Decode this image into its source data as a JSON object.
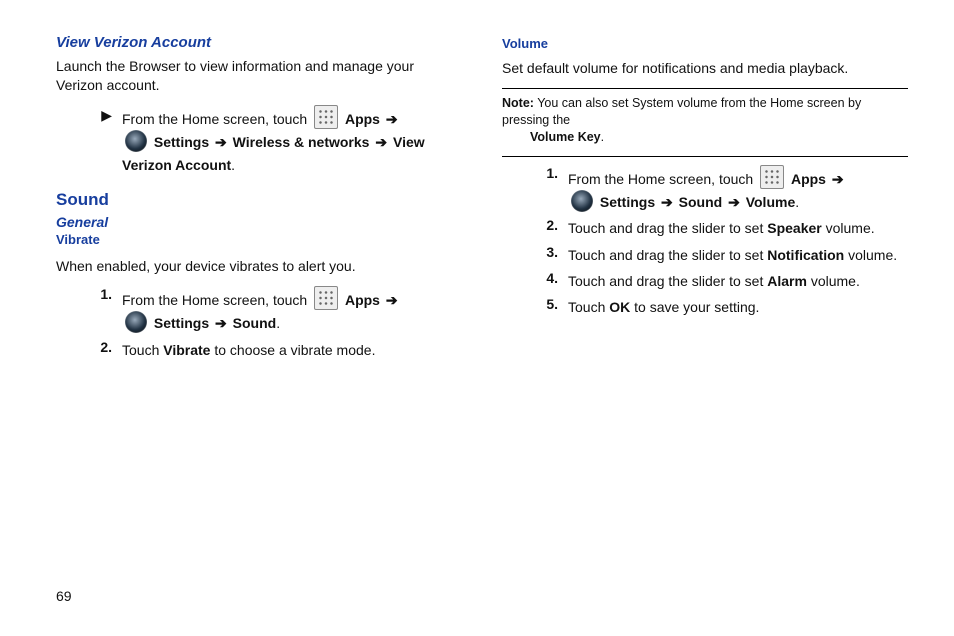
{
  "page_number": "69",
  "left": {
    "h1": "View Verizon Account",
    "p1": "Launch the Browser to view information and manage your Verizon account.",
    "bullet": {
      "marker": "▶",
      "pre": "From the Home screen, touch ",
      "apps": "Apps",
      "settings": "Settings",
      "path1": "Wireless & networks",
      "path2": "View Verizon Account",
      "arrow": "➔"
    },
    "h2": "Sound",
    "h3": "General",
    "h4": "Vibrate",
    "p2": "When enabled, your device vibrates to alert you.",
    "steps": [
      {
        "n": "1.",
        "pre": "From the Home screen, touch ",
        "apps": "Apps",
        "settings": "Settings",
        "tail": "Sound",
        "arrow": "➔"
      },
      {
        "n": "2.",
        "pre": "Touch ",
        "strong": "Vibrate",
        "post": " to choose a vibrate mode."
      }
    ]
  },
  "right": {
    "h1": "Volume",
    "p1": "Set default volume for notifications and media playback.",
    "note_label": "Note:",
    "note_text": "You can also set System volume from the Home screen by pressing the ",
    "note_strong": "Volume Key",
    "steps": [
      {
        "n": "1.",
        "pre": "From the Home screen, touch ",
        "apps": "Apps",
        "settings": "Settings",
        "path1": "Sound",
        "path2": "Volume",
        "arrow": "➔"
      },
      {
        "n": "2.",
        "pre": "Touch and drag the slider to set ",
        "strong": "Speaker",
        "post": " volume."
      },
      {
        "n": "3.",
        "pre": "Touch and drag the slider to set ",
        "strong": "Notification",
        "post": " volume."
      },
      {
        "n": "4.",
        "pre": "Touch and drag the slider to set ",
        "strong": "Alarm",
        "post": " volume."
      },
      {
        "n": "5.",
        "pre": "Touch ",
        "strong": "OK",
        "post": " to save your setting."
      }
    ]
  }
}
